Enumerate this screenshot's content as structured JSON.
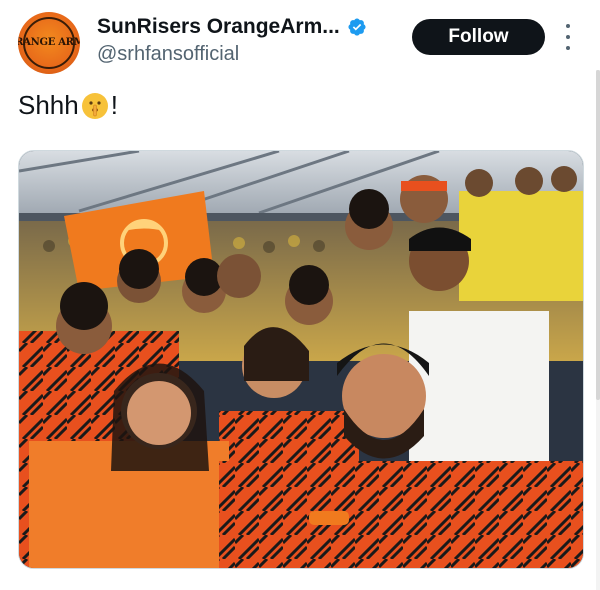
{
  "tweet": {
    "author": {
      "display_name": "SunRisers OrangeArm...",
      "handle": "@srhfansofficial",
      "verified": true,
      "avatar_text": "ORANGE ARMY",
      "avatar_icon": "orange-army-logo"
    },
    "follow_label": "Follow",
    "more_icon": "more-vertical-icon",
    "text_before_emoji": "Shhh",
    "emoji": "shushing-face-emoji",
    "text_after_emoji": "!",
    "media": {
      "type": "photo",
      "description_icon": "group-selfie-photo"
    }
  },
  "colors": {
    "follow_bg": "#0f1419",
    "verified": "#1d9bf0",
    "handle": "#536471",
    "srh_orange": "#f26522"
  }
}
